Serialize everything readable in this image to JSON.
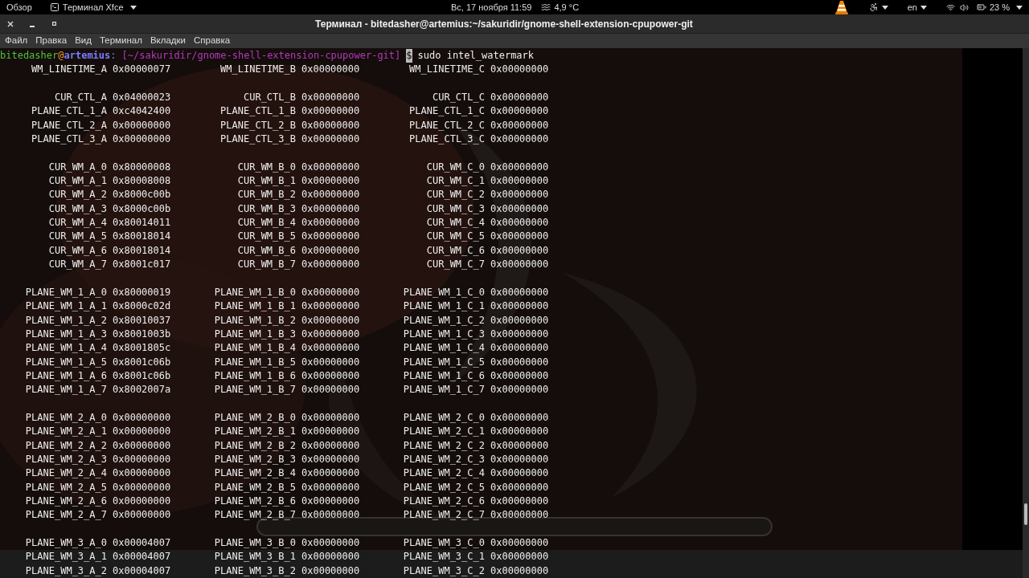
{
  "top_bar": {
    "overview": "Обзор",
    "app_menu": "Терминал Xfce",
    "clock": "Вс, 17 ноября 11:59",
    "weather": "4,9 °C",
    "keyboard_layout": "en",
    "battery": "23 %"
  },
  "window": {
    "title": "Терминал - bitedasher@artemius:~/sakuridir/gnome-shell-extension-cpupower-git"
  },
  "menu": [
    "Файл",
    "Правка",
    "Вид",
    "Терминал",
    "Вкладки",
    "Справка"
  ],
  "prompt": {
    "user": "bitedasher",
    "at": "@",
    "host": "artemius",
    "colon": ":",
    "path": "[~/sakuridir/gnome-shell-extension-cpupower-git]",
    "symbol": "$",
    "command": "sudo intel_watermark"
  },
  "groups": [
    [
      [
        [
          "WM_LINETIME_A",
          "0x00000077"
        ],
        [
          "WM_LINETIME_B",
          "0x00000000"
        ],
        [
          "WM_LINETIME_C",
          "0x00000000"
        ]
      ]
    ],
    [
      [
        [
          "CUR_CTL_A",
          "0x04000023"
        ],
        [
          "CUR_CTL_B",
          "0x00000000"
        ],
        [
          "CUR_CTL_C",
          "0x00000000"
        ]
      ],
      [
        [
          "PLANE_CTL_1_A",
          "0xc4042400"
        ],
        [
          "PLANE_CTL_1_B",
          "0x00000000"
        ],
        [
          "PLANE_CTL_1_C",
          "0x00000000"
        ]
      ],
      [
        [
          "PLANE_CTL_2_A",
          "0x00000000"
        ],
        [
          "PLANE_CTL_2_B",
          "0x00000000"
        ],
        [
          "PLANE_CTL_2_C",
          "0x00000000"
        ]
      ],
      [
        [
          "PLANE_CTL_3_A",
          "0x00000000"
        ],
        [
          "PLANE_CTL_3_B",
          "0x00000000"
        ],
        [
          "PLANE_CTL_3_C",
          "0x00000000"
        ]
      ]
    ],
    [
      [
        [
          "CUR_WM_A_0",
          "0x80000008"
        ],
        [
          "CUR_WM_B_0",
          "0x00000000"
        ],
        [
          "CUR_WM_C_0",
          "0x00000000"
        ]
      ],
      [
        [
          "CUR_WM_A_1",
          "0x80008008"
        ],
        [
          "CUR_WM_B_1",
          "0x00000000"
        ],
        [
          "CUR_WM_C_1",
          "0x00000000"
        ]
      ],
      [
        [
          "CUR_WM_A_2",
          "0x8000c00b"
        ],
        [
          "CUR_WM_B_2",
          "0x00000000"
        ],
        [
          "CUR_WM_C_2",
          "0x00000000"
        ]
      ],
      [
        [
          "CUR_WM_A_3",
          "0x8000c00b"
        ],
        [
          "CUR_WM_B_3",
          "0x00000000"
        ],
        [
          "CUR_WM_C_3",
          "0x00000000"
        ]
      ],
      [
        [
          "CUR_WM_A_4",
          "0x80014011"
        ],
        [
          "CUR_WM_B_4",
          "0x00000000"
        ],
        [
          "CUR_WM_C_4",
          "0x00000000"
        ]
      ],
      [
        [
          "CUR_WM_A_5",
          "0x80018014"
        ],
        [
          "CUR_WM_B_5",
          "0x00000000"
        ],
        [
          "CUR_WM_C_5",
          "0x00000000"
        ]
      ],
      [
        [
          "CUR_WM_A_6",
          "0x80018014"
        ],
        [
          "CUR_WM_B_6",
          "0x00000000"
        ],
        [
          "CUR_WM_C_6",
          "0x00000000"
        ]
      ],
      [
        [
          "CUR_WM_A_7",
          "0x8001c017"
        ],
        [
          "CUR_WM_B_7",
          "0x00000000"
        ],
        [
          "CUR_WM_C_7",
          "0x00000000"
        ]
      ]
    ],
    [
      [
        [
          "PLANE_WM_1_A_0",
          "0x80000019"
        ],
        [
          "PLANE_WM_1_B_0",
          "0x00000000"
        ],
        [
          "PLANE_WM_1_C_0",
          "0x00000000"
        ]
      ],
      [
        [
          "PLANE_WM_1_A_1",
          "0x8000c02d"
        ],
        [
          "PLANE_WM_1_B_1",
          "0x00000000"
        ],
        [
          "PLANE_WM_1_C_1",
          "0x00000000"
        ]
      ],
      [
        [
          "PLANE_WM_1_A_2",
          "0x80010037"
        ],
        [
          "PLANE_WM_1_B_2",
          "0x00000000"
        ],
        [
          "PLANE_WM_1_C_2",
          "0x00000000"
        ]
      ],
      [
        [
          "PLANE_WM_1_A_3",
          "0x8001003b"
        ],
        [
          "PLANE_WM_1_B_3",
          "0x00000000"
        ],
        [
          "PLANE_WM_1_C_3",
          "0x00000000"
        ]
      ],
      [
        [
          "PLANE_WM_1_A_4",
          "0x8001805c"
        ],
        [
          "PLANE_WM_1_B_4",
          "0x00000000"
        ],
        [
          "PLANE_WM_1_C_4",
          "0x00000000"
        ]
      ],
      [
        [
          "PLANE_WM_1_A_5",
          "0x8001c06b"
        ],
        [
          "PLANE_WM_1_B_5",
          "0x00000000"
        ],
        [
          "PLANE_WM_1_C_5",
          "0x00000000"
        ]
      ],
      [
        [
          "PLANE_WM_1_A_6",
          "0x8001c06b"
        ],
        [
          "PLANE_WM_1_B_6",
          "0x00000000"
        ],
        [
          "PLANE_WM_1_C_6",
          "0x00000000"
        ]
      ],
      [
        [
          "PLANE_WM_1_A_7",
          "0x8002007a"
        ],
        [
          "PLANE_WM_1_B_7",
          "0x00000000"
        ],
        [
          "PLANE_WM_1_C_7",
          "0x00000000"
        ]
      ]
    ],
    [
      [
        [
          "PLANE_WM_2_A_0",
          "0x00000000"
        ],
        [
          "PLANE_WM_2_B_0",
          "0x00000000"
        ],
        [
          "PLANE_WM_2_C_0",
          "0x00000000"
        ]
      ],
      [
        [
          "PLANE_WM_2_A_1",
          "0x00000000"
        ],
        [
          "PLANE_WM_2_B_1",
          "0x00000000"
        ],
        [
          "PLANE_WM_2_C_1",
          "0x00000000"
        ]
      ],
      [
        [
          "PLANE_WM_2_A_2",
          "0x00000000"
        ],
        [
          "PLANE_WM_2_B_2",
          "0x00000000"
        ],
        [
          "PLANE_WM_2_C_2",
          "0x00000000"
        ]
      ],
      [
        [
          "PLANE_WM_2_A_3",
          "0x00000000"
        ],
        [
          "PLANE_WM_2_B_3",
          "0x00000000"
        ],
        [
          "PLANE_WM_2_C_3",
          "0x00000000"
        ]
      ],
      [
        [
          "PLANE_WM_2_A_4",
          "0x00000000"
        ],
        [
          "PLANE_WM_2_B_4",
          "0x00000000"
        ],
        [
          "PLANE_WM_2_C_4",
          "0x00000000"
        ]
      ],
      [
        [
          "PLANE_WM_2_A_5",
          "0x00000000"
        ],
        [
          "PLANE_WM_2_B_5",
          "0x00000000"
        ],
        [
          "PLANE_WM_2_C_5",
          "0x00000000"
        ]
      ],
      [
        [
          "PLANE_WM_2_A_6",
          "0x00000000"
        ],
        [
          "PLANE_WM_2_B_6",
          "0x00000000"
        ],
        [
          "PLANE_WM_2_C_6",
          "0x00000000"
        ]
      ],
      [
        [
          "PLANE_WM_2_A_7",
          "0x00000000"
        ],
        [
          "PLANE_WM_2_B_7",
          "0x00000000"
        ],
        [
          "PLANE_WM_2_C_7",
          "0x00000000"
        ]
      ]
    ],
    [
      [
        [
          "PLANE_WM_3_A_0",
          "0x00004007"
        ],
        [
          "PLANE_WM_3_B_0",
          "0x00000000"
        ],
        [
          "PLANE_WM_3_C_0",
          "0x00000000"
        ]
      ],
      [
        [
          "PLANE_WM_3_A_1",
          "0x00004007"
        ],
        [
          "PLANE_WM_3_B_1",
          "0x00000000"
        ],
        [
          "PLANE_WM_3_C_1",
          "0x00000000"
        ]
      ],
      [
        [
          "PLANE_WM_3_A_2",
          "0x00004007"
        ],
        [
          "PLANE_WM_3_B_2",
          "0x00000000"
        ],
        [
          "PLANE_WM_3_C_2",
          "0x00000000"
        ]
      ]
    ]
  ]
}
